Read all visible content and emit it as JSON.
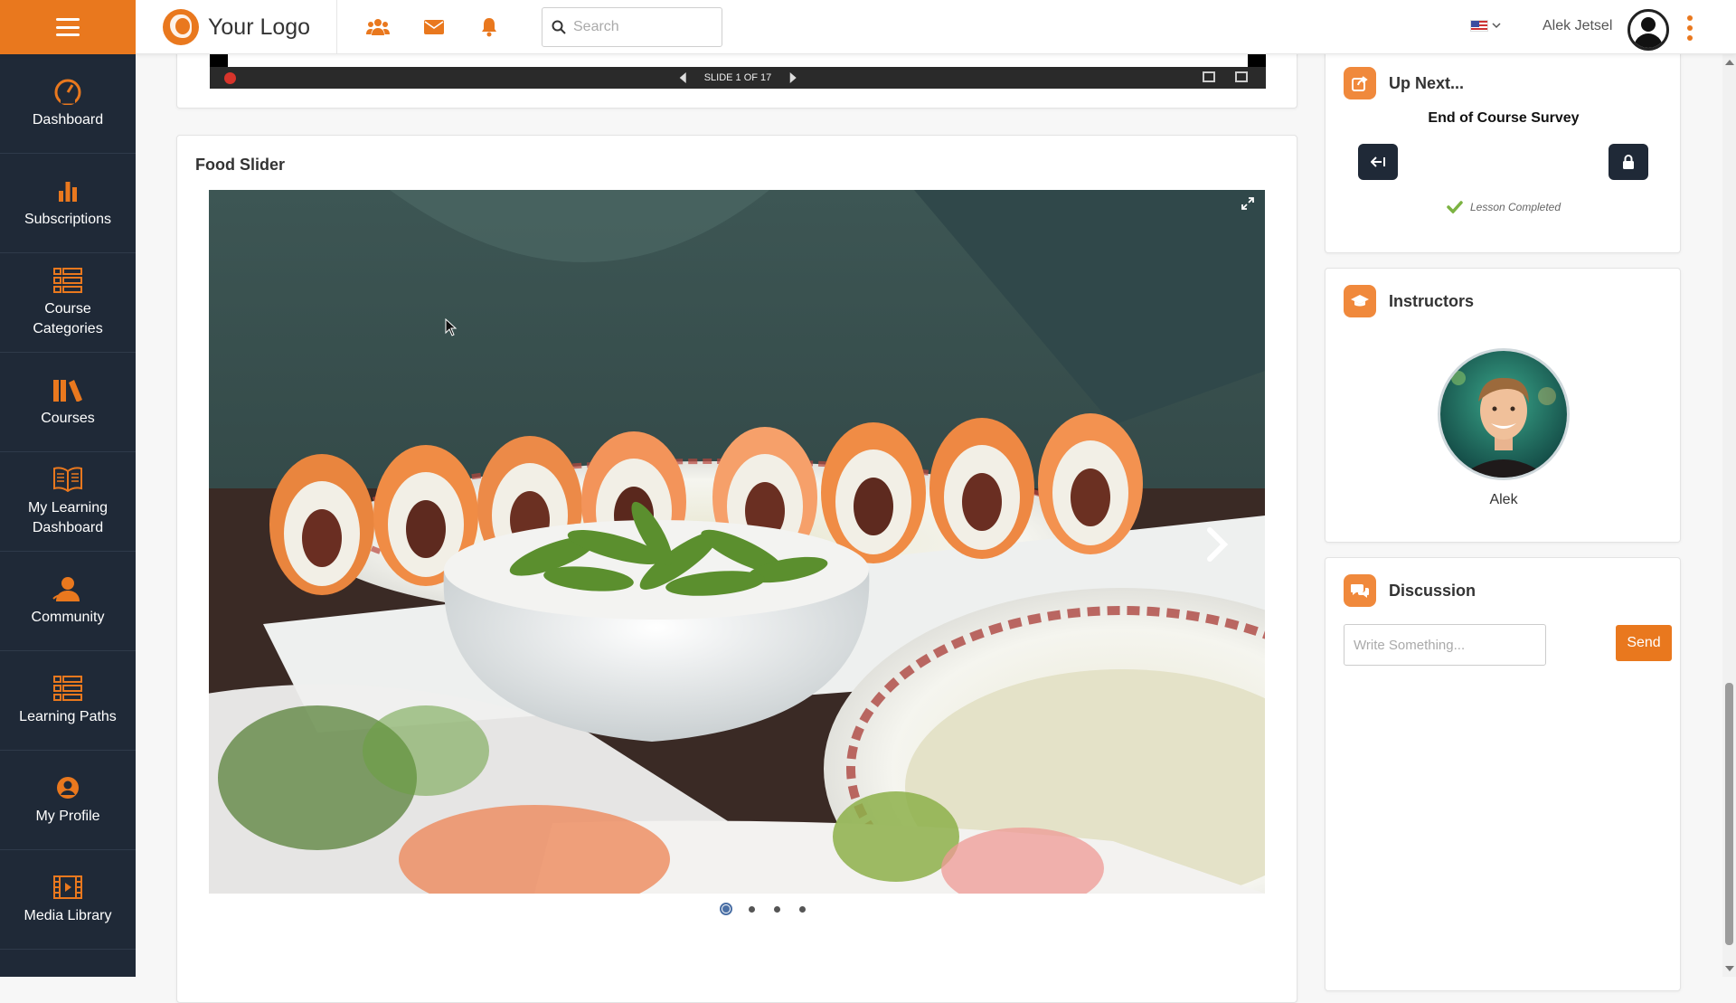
{
  "brand": {
    "logo_text": "Your Logo",
    "accent": "#e9781e",
    "sidebar_bg": "#1f2937"
  },
  "topbar": {
    "icons": [
      "users-icon",
      "envelope-icon",
      "bell-icon"
    ],
    "search_placeholder": "Search",
    "user_name": "Alek Jetsel"
  },
  "sidebar": {
    "items": [
      {
        "label": "Dashboard",
        "icon": "speedometer-icon"
      },
      {
        "label": "Subscriptions",
        "icon": "bar-chart-icon"
      },
      {
        "label": "Course Categories",
        "icon": "list-icon"
      },
      {
        "label": "Courses",
        "icon": "books-icon"
      },
      {
        "label": "My Learning Dashboard",
        "icon": "open-book-icon"
      },
      {
        "label": "Community",
        "icon": "community-icon"
      },
      {
        "label": "Learning Paths",
        "icon": "list-icon"
      },
      {
        "label": "My Profile",
        "icon": "user-circle-icon"
      },
      {
        "label": "Media Library",
        "icon": "film-icon"
      }
    ]
  },
  "presentation": {
    "slide_counter": "SLIDE 1 OF 17"
  },
  "food_slider": {
    "title": "Food Slider",
    "slide_count": 4,
    "active_slide": 1
  },
  "up_next": {
    "title": "Up Next...",
    "item_title": "End of Course Survey",
    "status": "Lesson Completed"
  },
  "instructors": {
    "title": "Instructors",
    "name": "Alek"
  },
  "discussion": {
    "title": "Discussion",
    "input_placeholder": "Write Something...",
    "send_label": "Send"
  }
}
